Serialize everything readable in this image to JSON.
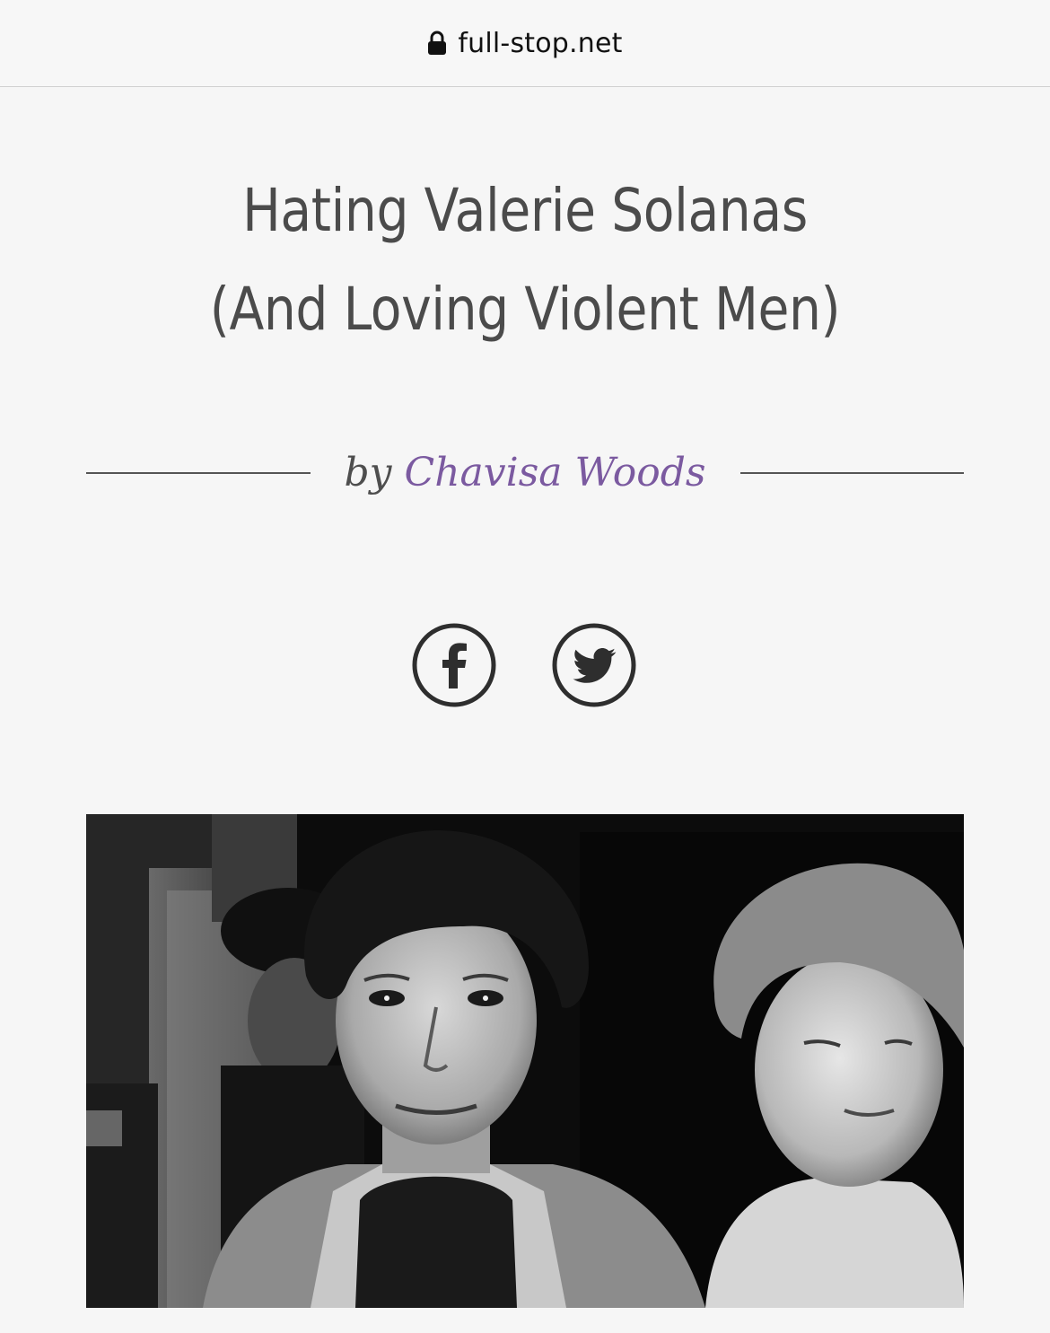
{
  "browser": {
    "url": "full-stop.net",
    "lock_icon": "lock-icon"
  },
  "article": {
    "title_line_1": "Hating Valerie Solanas",
    "title_line_2": "(And Loving Violent Men)",
    "byline_prefix": "by",
    "author": "Chavisa Woods",
    "author_color": "#7b5aa0"
  },
  "share": {
    "icons": [
      "facebook-icon",
      "twitter-icon"
    ]
  },
  "image": {
    "kind": "black-and-white photograph"
  }
}
